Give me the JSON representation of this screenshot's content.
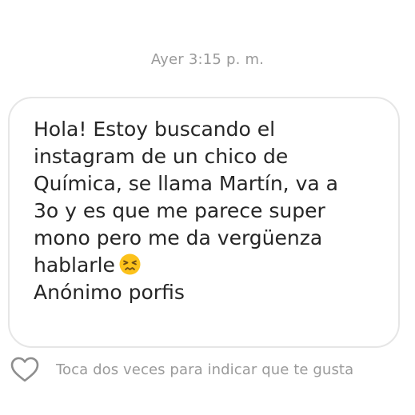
{
  "thread": {
    "timestamp": "Ayer 3:15 p. m."
  },
  "message": {
    "lines": [
      "Hola! Estoy buscando el",
      "instagram de un chico de",
      "Química, se llama Martín, va a",
      "3o y es que me parece super",
      "mono pero me da vergüenza",
      "hablarle"
    ],
    "signature": "Anónimo porfis",
    "emoji": "persevering-face-emoji",
    "text_color": "#262626"
  },
  "reaction": {
    "icon": "heart-outline-icon",
    "hint": "Toca dos veces para indicar que te gusta"
  },
  "colors": {
    "bubble_border": "#e6e6e6",
    "muted_text": "#9a9a9a",
    "emoji_yellow": "#fcc21b"
  }
}
